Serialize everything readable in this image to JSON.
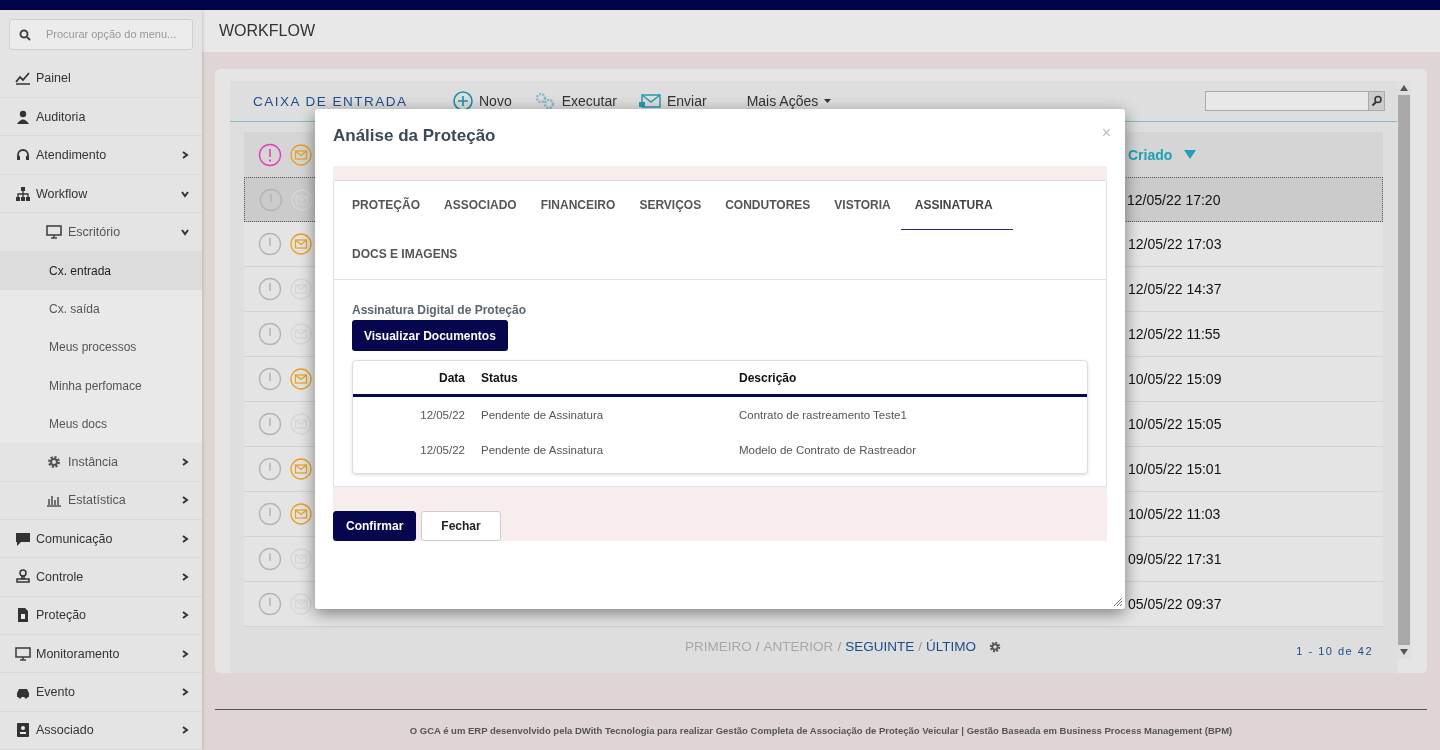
{
  "sidebar": {
    "search": {
      "placeholder": "Procurar opção do menu..."
    },
    "items": [
      {
        "label": "Painel",
        "selected": false
      },
      {
        "label": "Auditoria",
        "selected": false
      },
      {
        "label": "Atendimento",
        "selected": false,
        "expanded": false
      },
      {
        "label": "Workflow",
        "selected": false,
        "expanded": true,
        "children": [
          {
            "label": "Escritório",
            "selected": false,
            "expanded": true,
            "children": [
              {
                "label": "Cx. entrada",
                "selected": true
              },
              {
                "label": "Cx. saída",
                "selected": false
              },
              {
                "label": "Meus processos",
                "selected": false
              },
              {
                "label": "Minha perfomace",
                "selected": false
              },
              {
                "label": "Meus docs",
                "selected": false
              }
            ]
          },
          {
            "label": "Instância",
            "selected": false,
            "expanded": false
          },
          {
            "label": "Estatística",
            "selected": false,
            "expanded": false
          }
        ]
      },
      {
        "label": "Comunicação",
        "selected": false,
        "expanded": false
      },
      {
        "label": "Controle",
        "selected": false,
        "expanded": false
      },
      {
        "label": "Proteção",
        "selected": false,
        "expanded": false
      },
      {
        "label": "Monitoramento",
        "selected": false,
        "expanded": false
      },
      {
        "label": "Evento",
        "selected": false,
        "expanded": false
      },
      {
        "label": "Associado",
        "selected": false,
        "expanded": false
      }
    ]
  },
  "page": {
    "title": "WORKFLOW"
  },
  "inbox": {
    "title": "CAIXA DE ENTRADA",
    "actions": [
      {
        "label": "Novo",
        "kind": "new"
      },
      {
        "label": "Executar",
        "kind": "run"
      },
      {
        "label": "Enviar",
        "kind": "send"
      },
      {
        "label": "Mais Ações",
        "kind": "menu"
      }
    ],
    "table": {
      "columns": [
        {
          "label": "Criado",
          "sorted": true
        }
      ],
      "rows": [
        {
          "created": "12/05/22 17:20",
          "unread": false,
          "selected": true
        },
        {
          "created": "12/05/22 17:03",
          "unread": true,
          "selected": false
        },
        {
          "created": "12/05/22 14:37",
          "unread": false,
          "selected": false
        },
        {
          "created": "12/05/22 11:55",
          "unread": false,
          "selected": false
        },
        {
          "created": "10/05/22 15:09",
          "unread": true,
          "selected": false
        },
        {
          "created": "10/05/22 15:05",
          "unread": false,
          "selected": false
        },
        {
          "created": "10/05/22 15:01",
          "unread": true,
          "selected": false
        },
        {
          "created": "10/05/22 11:03",
          "unread": true,
          "selected": false
        },
        {
          "created": "09/05/22 17:31",
          "unread": false,
          "selected": false
        },
        {
          "created": "05/05/22 09:37",
          "unread": false,
          "selected": false
        }
      ]
    },
    "pager": [
      {
        "kind": "link",
        "label": "PRIMEIRO",
        "disabled": true
      },
      {
        "kind": "sep",
        "label": "/"
      },
      {
        "kind": "link",
        "label": "ANTERIOR",
        "disabled": true
      },
      {
        "kind": "sep",
        "label": "/"
      },
      {
        "kind": "link",
        "label": "SEGUINTE",
        "disabled": false
      },
      {
        "kind": "sep",
        "label": "/"
      },
      {
        "kind": "link",
        "label": "ÚLTIMO",
        "disabled": false
      }
    ],
    "count": "1 - 10 de 42"
  },
  "modal": {
    "title": "Análise da Proteção",
    "close": "×",
    "tabs": [
      {
        "label": "PROTEÇÃO",
        "selected": false
      },
      {
        "label": "ASSOCIADO",
        "selected": false
      },
      {
        "label": "FINANCEIRO",
        "selected": false
      },
      {
        "label": "SERVIÇOS",
        "selected": false
      },
      {
        "label": "CONDUTORES",
        "selected": false
      },
      {
        "label": "VISTORIA",
        "selected": false
      },
      {
        "label": "ASSINATURA",
        "selected": true
      },
      {
        "label": "DOCS E IMAGENS",
        "selected": false
      }
    ],
    "section_title": "Assinatura Digital de Proteção",
    "view_button": "Visualizar Documentos",
    "documents": {
      "columns": [
        "Data",
        "Status",
        "Descrição"
      ],
      "rows": [
        {
          "date": "12/05/22",
          "status": "Pendente de Assinatura",
          "description": "Contrato de rastreamento Teste1"
        },
        {
          "date": "12/05/22",
          "status": "Pendente de Assinatura",
          "description": "Modelo de Contrato de Rastreador"
        }
      ]
    },
    "buttons": [
      {
        "label": "Confirmar",
        "kind": "primary"
      },
      {
        "label": "Fechar",
        "kind": "secondary"
      }
    ]
  },
  "footer": "O GCA é um ERP desenvolvido pela DWith Tecnologia para realizar Gestão Completa de Associação de Proteção Veicular | Gestão Baseada em Business Process Management (BPM)"
}
